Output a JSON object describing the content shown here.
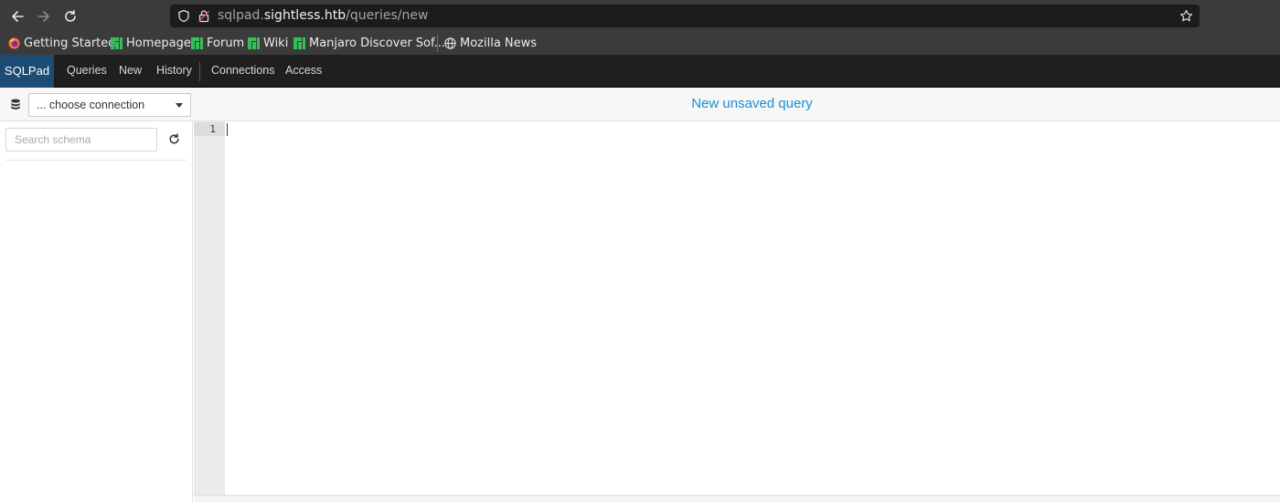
{
  "browser": {
    "url_scheme_prefix": "sqlpad.",
    "url_host": "sightless.htb",
    "url_path": "/queries/new",
    "bookmarks": [
      {
        "label": "Getting Started",
        "icon": "firefox-icon"
      },
      {
        "label": "Homepage",
        "icon": "manjaro-icon"
      },
      {
        "label": "Forum",
        "icon": "manjaro-icon"
      },
      {
        "label": "Wiki",
        "icon": "manjaro-icon"
      },
      {
        "label": "Manjaro Discover Sof...",
        "icon": "manjaro-icon"
      },
      {
        "label": "Mozilla News",
        "icon": "globe-icon"
      }
    ]
  },
  "app": {
    "brand": "SQLPad",
    "nav": {
      "queries": "Queries",
      "new": "New",
      "history": "History",
      "connections": "Connections",
      "access": "Access"
    },
    "toolbar": {
      "connection_select": "... choose connection",
      "query_title": "New unsaved query"
    },
    "schema": {
      "search_placeholder": "Search schema"
    },
    "editor": {
      "line_numbers": [
        "1"
      ]
    }
  },
  "colors": {
    "brand_bg": "#1c4b73",
    "title_accent": "#1a8fd6",
    "manjaro_green": "#35bf5c"
  }
}
